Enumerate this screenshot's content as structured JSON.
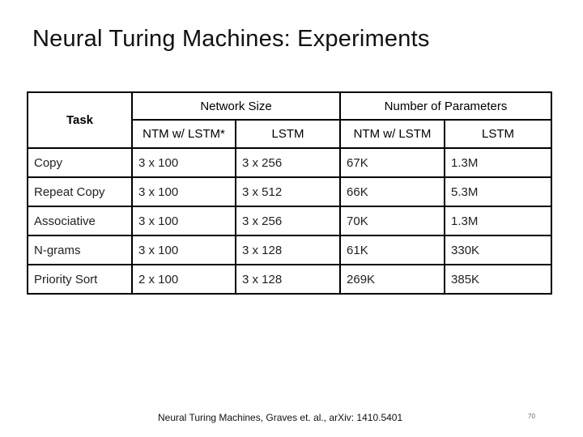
{
  "title": "Neural Turing Machines: Experiments",
  "table": {
    "task_header": "Task",
    "groups": [
      {
        "label": "Network Size",
        "sub": [
          "NTM w/ LSTM*",
          "LSTM"
        ]
      },
      {
        "label": "Number of Parameters",
        "sub": [
          "NTM w/ LSTM",
          "LSTM"
        ]
      }
    ],
    "rows": [
      {
        "task": "Copy",
        "ntm_size": "3 x 100",
        "lstm_size": "3 x 256",
        "ntm_params": "67K",
        "lstm_params": "1.3M"
      },
      {
        "task": "Repeat Copy",
        "ntm_size": "3 x 100",
        "lstm_size": "3 x 512",
        "ntm_params": "66K",
        "lstm_params": "5.3M"
      },
      {
        "task": "Associative",
        "ntm_size": "3 x 100",
        "lstm_size": "3 x 256",
        "ntm_params": "70K",
        "lstm_params": "1.3M"
      },
      {
        "task": "N-grams",
        "ntm_size": "3 x 100",
        "lstm_size": "3 x 128",
        "ntm_params": "61K",
        "lstm_params": "330K"
      },
      {
        "task": "Priority Sort",
        "ntm_size": "2 x 100",
        "lstm_size": "3 x 128",
        "ntm_params": "269K",
        "lstm_params": "385K"
      }
    ]
  },
  "citation": "Neural Turing Machines, Graves et. al., arXiv: 1410.5401",
  "page_number": "70"
}
